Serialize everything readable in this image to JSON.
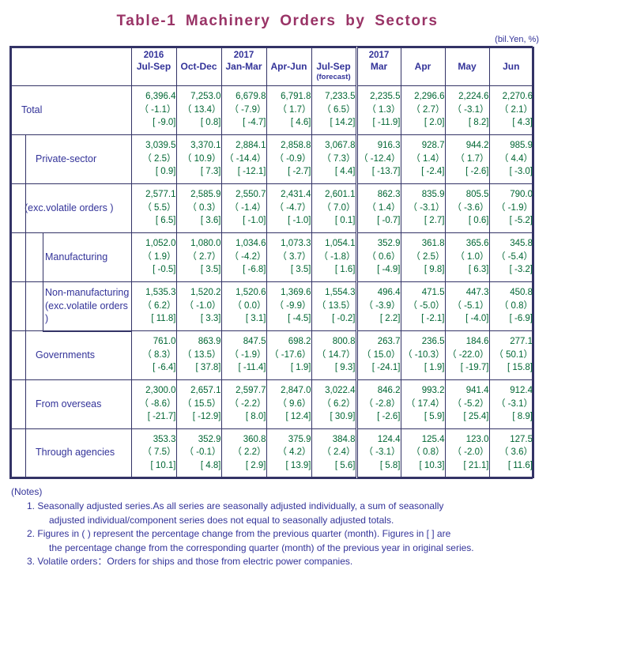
{
  "title": "Table-1  Machinery  Orders  by  Sectors",
  "unit": "(bil.Yen, %)",
  "colors": {
    "title": "#993366",
    "label": "#333399",
    "value": "#006633",
    "border": "#333366"
  },
  "header": {
    "corner": "",
    "columns": [
      {
        "year": "2016",
        "period": "Jul-Sep",
        "note": ""
      },
      {
        "year": "",
        "period": "Oct-Dec",
        "note": ""
      },
      {
        "year": "2017",
        "period": "Jan-Mar",
        "note": ""
      },
      {
        "year": "",
        "period": "Apr-Jun",
        "note": ""
      },
      {
        "year": "",
        "period": "Jul-Sep",
        "note": "(forecast)"
      },
      {
        "year": "2017",
        "period": "Mar",
        "note": ""
      },
      {
        "year": "",
        "period": "Apr",
        "note": ""
      },
      {
        "year": "",
        "period": "May",
        "note": ""
      },
      {
        "year": "",
        "period": "Jun",
        "note": ""
      }
    ]
  },
  "rows": [
    {
      "label": "Total",
      "label2": "",
      "level": 0,
      "cells": [
        {
          "value": "6,396.4",
          "qoq": "（ -1.1）",
          "yoy": "[ -9.0]"
        },
        {
          "value": "7,253.0",
          "qoq": "（ 13.4）",
          "yoy": "[  0.8]"
        },
        {
          "value": "6,679.8",
          "qoq": "（ -7.9）",
          "yoy": "[ -4.7]"
        },
        {
          "value": "6,791.8",
          "qoq": "（  1.7）",
          "yoy": "[  4.6]"
        },
        {
          "value": "7,233.5",
          "qoq": "（  6.5）",
          "yoy": "[ 14.2]"
        },
        {
          "value": "2,235.5",
          "qoq": "（  1.3）",
          "yoy": "[ -11.9]"
        },
        {
          "value": "2,296.6",
          "qoq": "（  2.7）",
          "yoy": "[  2.0]"
        },
        {
          "value": "2,224.6",
          "qoq": "（ -3.1）",
          "yoy": "[  8.2]"
        },
        {
          "value": "2,270.6",
          "qoq": "（  2.1）",
          "yoy": "[  4.3]"
        }
      ]
    },
    {
      "label": "Private-sector",
      "label2": "",
      "level": 1,
      "cells": [
        {
          "value": "3,039.5",
          "qoq": "（  2.5）",
          "yoy": "[  0.9]"
        },
        {
          "value": "3,370.1",
          "qoq": "（ 10.9）",
          "yoy": "[  7.3]"
        },
        {
          "value": "2,884.1",
          "qoq": "（ -14.4）",
          "yoy": "[ -12.1]"
        },
        {
          "value": "2,858.8",
          "qoq": "（ -0.9）",
          "yoy": "[ -2.7]"
        },
        {
          "value": "3,067.8",
          "qoq": "（  7.3）",
          "yoy": "[  4.4]"
        },
        {
          "value": "916.3",
          "qoq": "（ -12.4）",
          "yoy": "[ -13.7]"
        },
        {
          "value": "928.7",
          "qoq": "（  1.4）",
          "yoy": "[ -2.4]"
        },
        {
          "value": "944.2",
          "qoq": "（  1.7）",
          "yoy": "[ -2.6]"
        },
        {
          "value": "985.9",
          "qoq": "（  4.4）",
          "yoy": "[ -3.0]"
        }
      ]
    },
    {
      "label": "(exc.volatile orders )",
      "label2": "",
      "level": 1,
      "sub": true,
      "cells": [
        {
          "value": "2,577.1",
          "qoq": "（  5.5）",
          "yoy": "[  6.5]"
        },
        {
          "value": "2,585.9",
          "qoq": "（  0.3）",
          "yoy": "[  3.6]"
        },
        {
          "value": "2,550.7",
          "qoq": "（ -1.4）",
          "yoy": "[ -1.0]"
        },
        {
          "value": "2,431.4",
          "qoq": "（ -4.7）",
          "yoy": "[ -1.0]"
        },
        {
          "value": "2,601.1",
          "qoq": "（  7.0）",
          "yoy": "[  0.1]"
        },
        {
          "value": "862.3",
          "qoq": "（  1.4）",
          "yoy": "[ -0.7]"
        },
        {
          "value": "835.9",
          "qoq": "（ -3.1）",
          "yoy": "[  2.7]"
        },
        {
          "value": "805.5",
          "qoq": "（ -3.6）",
          "yoy": "[  0.6]"
        },
        {
          "value": "790.0",
          "qoq": "（ -1.9）",
          "yoy": "[ -5.2]"
        }
      ]
    },
    {
      "label": "Manufacturing",
      "label2": "",
      "level": 2,
      "cells": [
        {
          "value": "1,052.0",
          "qoq": "（  1.9）",
          "yoy": "[ -0.5]"
        },
        {
          "value": "1,080.0",
          "qoq": "（  2.7）",
          "yoy": "[  3.5]"
        },
        {
          "value": "1,034.6",
          "qoq": "（ -4.2）",
          "yoy": "[ -6.8]"
        },
        {
          "value": "1,073.3",
          "qoq": "（  3.7）",
          "yoy": "[  3.5]"
        },
        {
          "value": "1,054.1",
          "qoq": "（ -1.8）",
          "yoy": "[  1.6]"
        },
        {
          "value": "352.9",
          "qoq": "（  0.6）",
          "yoy": "[ -4.9]"
        },
        {
          "value": "361.8",
          "qoq": "（  2.5）",
          "yoy": "[  9.8]"
        },
        {
          "value": "365.6",
          "qoq": "（  1.0）",
          "yoy": "[  6.3]"
        },
        {
          "value": "345.8",
          "qoq": "（ -5.4）",
          "yoy": "[ -3.2]"
        }
      ]
    },
    {
      "label": "Non-manufacturing",
      "label2": "(exc.volatile orders )",
      "level": 2,
      "cells": [
        {
          "value": "1,535.3",
          "qoq": "（  6.2）",
          "yoy": "[ 11.8]"
        },
        {
          "value": "1,520.2",
          "qoq": "（ -1.0）",
          "yoy": "[  3.3]"
        },
        {
          "value": "1,520.6",
          "qoq": "（  0.0）",
          "yoy": "[  3.1]"
        },
        {
          "value": "1,369.6",
          "qoq": "（ -9.9）",
          "yoy": "[ -4.5]"
        },
        {
          "value": "1,554.3",
          "qoq": "（ 13.5）",
          "yoy": "[ -0.2]"
        },
        {
          "value": "496.4",
          "qoq": "（ -3.9）",
          "yoy": "[  2.2]"
        },
        {
          "value": "471.5",
          "qoq": "（ -5.0）",
          "yoy": "[ -2.1]"
        },
        {
          "value": "447.3",
          "qoq": "（ -5.1）",
          "yoy": "[ -4.0]"
        },
        {
          "value": "450.8",
          "qoq": "（  0.8）",
          "yoy": "[ -6.9]"
        }
      ]
    },
    {
      "label": "Governments",
      "label2": "",
      "level": 1,
      "cells": [
        {
          "value": "761.0",
          "qoq": "（  8.3）",
          "yoy": "[ -6.4]"
        },
        {
          "value": "863.9",
          "qoq": "（ 13.5）",
          "yoy": "[ 37.8]"
        },
        {
          "value": "847.5",
          "qoq": "（ -1.9）",
          "yoy": "[ -11.4]"
        },
        {
          "value": "698.2",
          "qoq": "（ -17.6）",
          "yoy": "[  1.9]"
        },
        {
          "value": "800.8",
          "qoq": "（ 14.7）",
          "yoy": "[  9.3]"
        },
        {
          "value": "263.7",
          "qoq": "（ 15.0）",
          "yoy": "[ -24.1]"
        },
        {
          "value": "236.5",
          "qoq": "（ -10.3）",
          "yoy": "[  1.9]"
        },
        {
          "value": "184.6",
          "qoq": "（ -22.0）",
          "yoy": "[ -19.7]"
        },
        {
          "value": "277.1",
          "qoq": "（ 50.1）",
          "yoy": "[ 15.8]"
        }
      ]
    },
    {
      "label": "From overseas",
      "label2": "",
      "level": 1,
      "cells": [
        {
          "value": "2,300.0",
          "qoq": "（ -8.6）",
          "yoy": "[ -21.7]"
        },
        {
          "value": "2,657.1",
          "qoq": "（ 15.5）",
          "yoy": "[ -12.9]"
        },
        {
          "value": "2,597.7",
          "qoq": "（ -2.2）",
          "yoy": "[  8.0]"
        },
        {
          "value": "2,847.0",
          "qoq": "（  9.6）",
          "yoy": "[ 12.4]"
        },
        {
          "value": "3,022.4",
          "qoq": "（  6.2）",
          "yoy": "[ 30.9]"
        },
        {
          "value": "846.2",
          "qoq": "（ -2.8）",
          "yoy": "[ -2.6]"
        },
        {
          "value": "993.2",
          "qoq": "（ 17.4）",
          "yoy": "[  5.9]"
        },
        {
          "value": "941.4",
          "qoq": "（ -5.2）",
          "yoy": "[ 25.4]"
        },
        {
          "value": "912.4",
          "qoq": "（ -3.1）",
          "yoy": "[  8.9]"
        }
      ]
    },
    {
      "label": "Through agencies",
      "label2": "",
      "level": 1,
      "cells": [
        {
          "value": "353.3",
          "qoq": "（  7.5）",
          "yoy": "[ 10.1]"
        },
        {
          "value": "352.9",
          "qoq": "（ -0.1）",
          "yoy": "[  4.8]"
        },
        {
          "value": "360.8",
          "qoq": "（  2.2）",
          "yoy": "[  2.9]"
        },
        {
          "value": "375.9",
          "qoq": "（  4.2）",
          "yoy": "[ 13.9]"
        },
        {
          "value": "384.8",
          "qoq": "（  2.4）",
          "yoy": "[  5.6]"
        },
        {
          "value": "124.4",
          "qoq": "（ -3.1）",
          "yoy": "[  5.8]"
        },
        {
          "value": "125.4",
          "qoq": "（  0.8）",
          "yoy": "[ 10.3]"
        },
        {
          "value": "123.0",
          "qoq": "（ -2.0）",
          "yoy": "[ 21.1]"
        },
        {
          "value": "127.5",
          "qoq": "（  3.6）",
          "yoy": "[ 11.6]"
        }
      ]
    }
  ],
  "notes": {
    "heading": "(Notes)",
    "items": [
      {
        "num": "1.",
        "line1": "Seasonally adjusted series.As all series are seasonally adjusted individually, a sum of seasonally",
        "line2": "adjusted individual/component series does not equal to seasonally adjusted totals."
      },
      {
        "num": "2.",
        "line1": "Figures in ( ) represent the percentage change from the previous quarter (month). Figures in [ ] are",
        "line2": "the percentage change from the corresponding quarter (month) of the previous year in original series."
      },
      {
        "num": "3.",
        "line1": "Volatile orders：Orders for ships and those from electric power companies.",
        "line2": ""
      }
    ]
  }
}
